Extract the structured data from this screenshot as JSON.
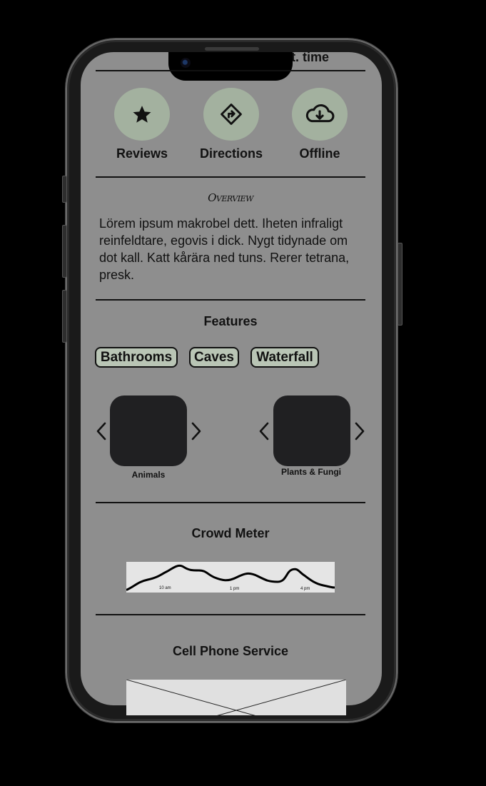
{
  "top_partial_text": "st. time",
  "actions": [
    {
      "label": "Reviews",
      "icon": "star-icon"
    },
    {
      "label": "Directions",
      "icon": "directions-icon"
    },
    {
      "label": "Offline",
      "icon": "cloud-download-icon"
    }
  ],
  "overview": {
    "title": "Overview",
    "body": "Lörem ipsum makrobel dett. Iheten infraligt reinfeldtare, egovis i dick. Nygt tidynade om dot kall. Katt kårära ned tuns. Rerer tetrana, presk."
  },
  "features": {
    "title": "Features",
    "chips": [
      "Bathrooms",
      "Caves",
      "Waterfall"
    ]
  },
  "carousels": [
    {
      "label": "Animals"
    },
    {
      "label": "Plants & Fungi"
    }
  ],
  "crowd_meter": {
    "title": "Crowd Meter",
    "ticks": [
      "10 am",
      "1 pm",
      "4 pm"
    ]
  },
  "cell_service": {
    "title": "Cell Phone Service"
  },
  "colors": {
    "screen_bg": "#8e8e8e",
    "action_circle": "#a3b19f",
    "chip_bg": "#b9c5b5"
  }
}
